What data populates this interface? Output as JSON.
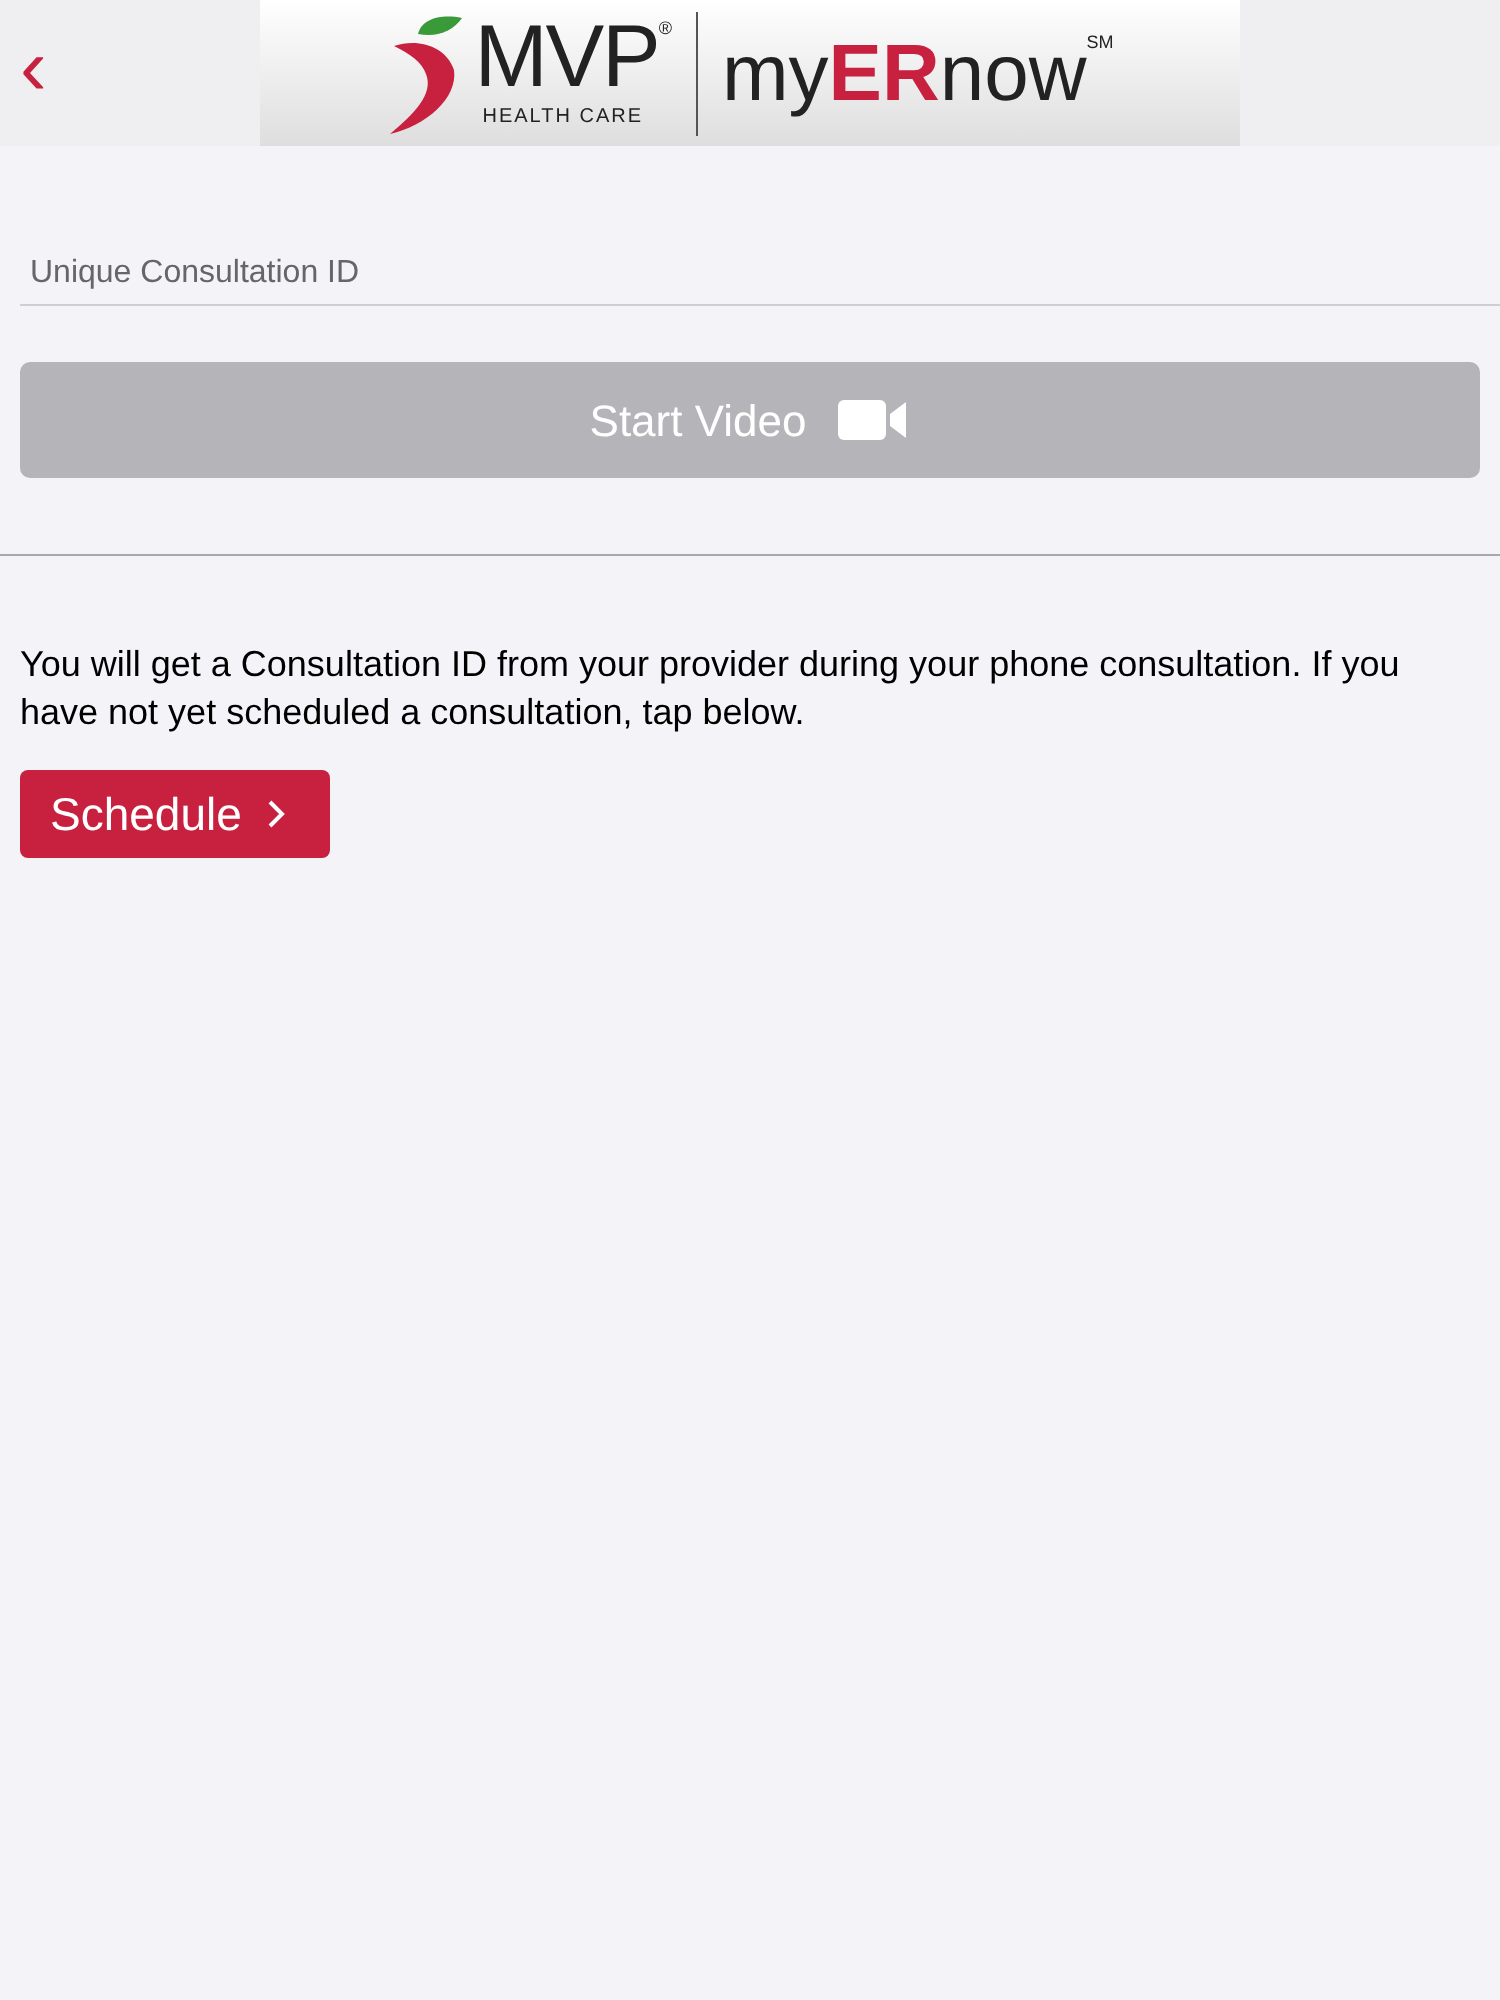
{
  "header": {
    "back_label": "‹",
    "logo": {
      "brand": "MVP",
      "brand_mark": "®",
      "brand_sub": "HEALTH CARE",
      "product_parts": [
        {
          "text": "my",
          "accent": false
        },
        {
          "text": "ER",
          "accent": true
        },
        {
          "text": "now",
          "accent": false
        }
      ],
      "product_mark": "SM"
    }
  },
  "consultation_field": {
    "placeholder": "Unique Consultation ID"
  },
  "start_video_button": {
    "label": "Start Video",
    "disabled": true
  },
  "info_text": "You will get a Consultation ID from your provider during your phone consultation. If you have not yet scheduled a consultation, tap below.",
  "schedule_button": {
    "label": "Schedule"
  }
}
